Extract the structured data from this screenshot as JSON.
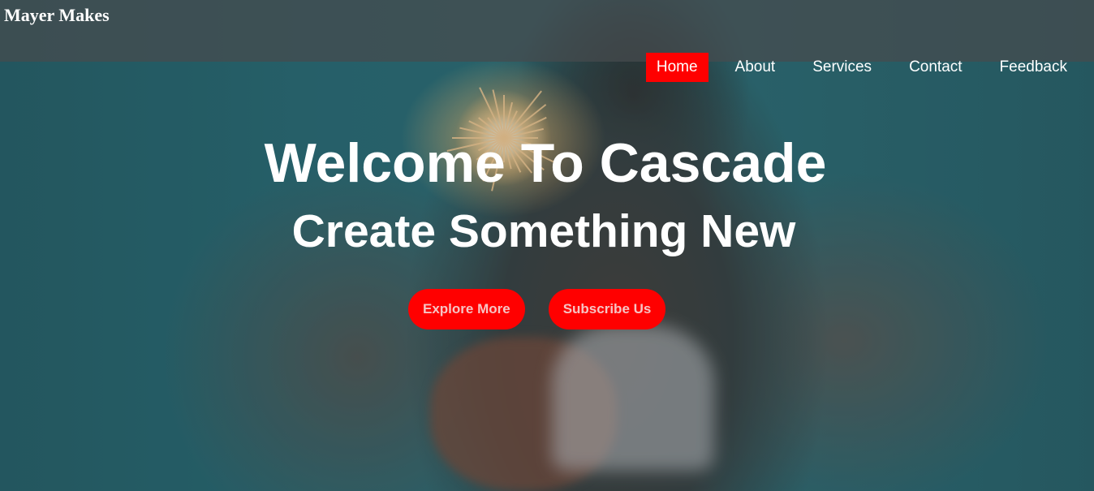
{
  "brand": {
    "name": "Mayer Makes"
  },
  "nav": {
    "items": [
      {
        "label": "Home"
      },
      {
        "label": "About"
      },
      {
        "label": "Services"
      },
      {
        "label": "Contact"
      },
      {
        "label": "Feedback"
      }
    ],
    "active": "Home"
  },
  "hero": {
    "title": "Welcome To Cascade",
    "subtitle": "Create Something New",
    "background_image": "sparkler-photo",
    "buttons": [
      {
        "label": "Explore More"
      },
      {
        "label": "Subscribe Us"
      }
    ]
  },
  "colors": {
    "accent": "#ff0000",
    "header_bg": "#464b4e",
    "text": "#ffffff"
  }
}
